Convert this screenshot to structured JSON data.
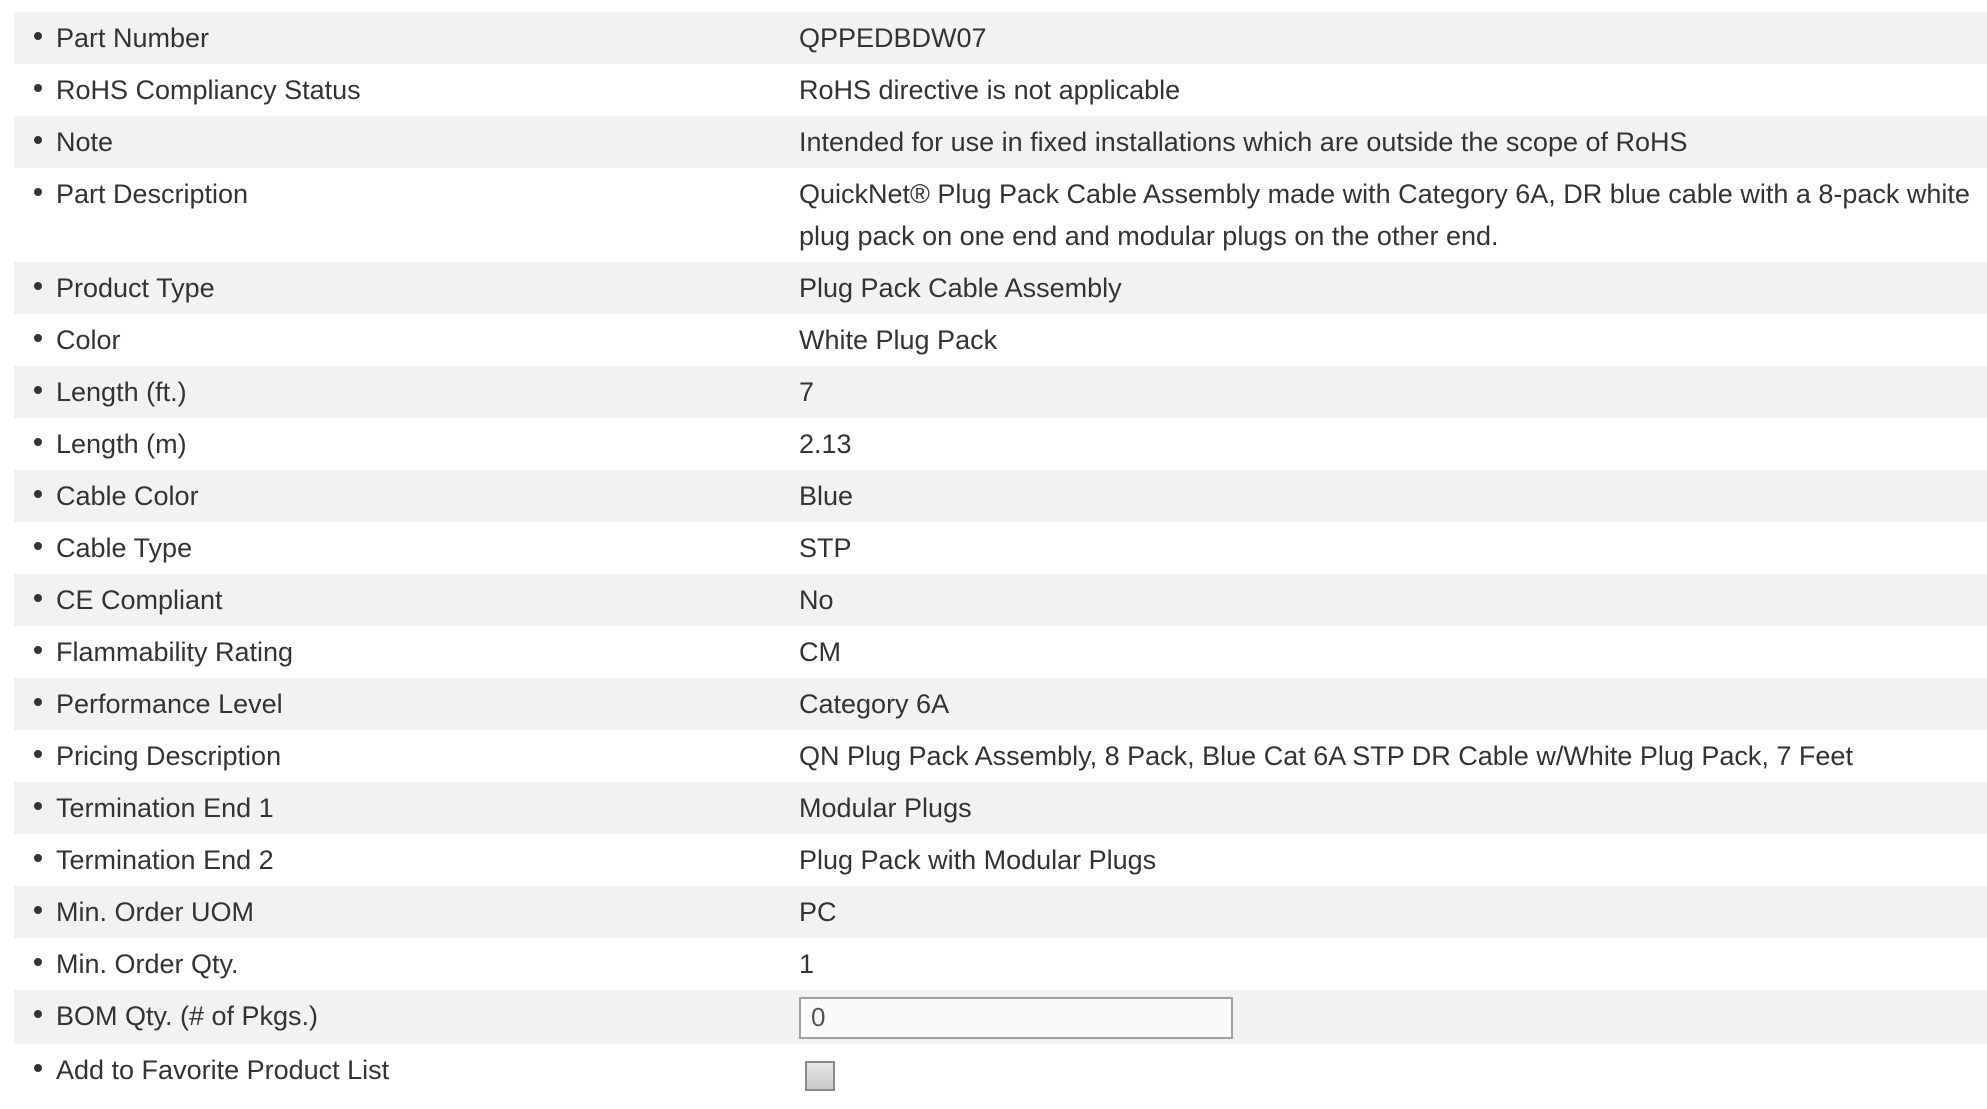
{
  "rows": [
    {
      "label": "Part Number",
      "value": "QPPEDBDW07"
    },
    {
      "label": "RoHS Compliancy Status",
      "value": "RoHS directive is not applicable"
    },
    {
      "label": "Note",
      "value": "Intended for use in fixed installations which are outside the scope of RoHS"
    },
    {
      "label": "Part Description",
      "value": "QuickNet® Plug Pack Cable Assembly made with Category 6A, DR blue cable with a 8-pack white plug pack on one end and modular plugs on the other end."
    },
    {
      "label": "Product Type",
      "value": "Plug Pack Cable Assembly"
    },
    {
      "label": "Color",
      "value": "White Plug Pack"
    },
    {
      "label": "Length (ft.)",
      "value": "7"
    },
    {
      "label": "Length (m)",
      "value": "2.13"
    },
    {
      "label": "Cable Color",
      "value": "Blue"
    },
    {
      "label": "Cable Type",
      "value": "STP"
    },
    {
      "label": "CE Compliant",
      "value": "No"
    },
    {
      "label": "Flammability Rating",
      "value": "CM"
    },
    {
      "label": "Performance Level",
      "value": "Category 6A"
    },
    {
      "label": "Pricing Description",
      "value": "QN Plug Pack Assembly, 8 Pack, Blue Cat 6A STP DR Cable w/White Plug Pack, 7 Feet"
    },
    {
      "label": "Termination End 1",
      "value": "Modular Plugs"
    },
    {
      "label": "Termination End 2",
      "value": "Plug Pack with Modular Plugs"
    },
    {
      "label": "Min. Order UOM",
      "value": "PC"
    },
    {
      "label": "Min. Order Qty.",
      "value": "1"
    }
  ],
  "bom": {
    "label": "BOM Qty. (# of Pkgs.)",
    "value": "0"
  },
  "favorite": {
    "label": "Add to Favorite Product List",
    "checked": false
  },
  "icons": {
    "bullet": "bullet-dot-icon"
  }
}
